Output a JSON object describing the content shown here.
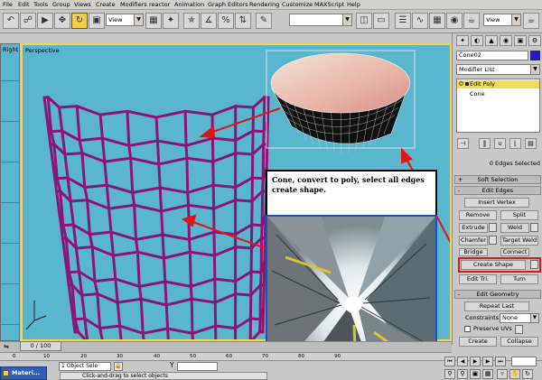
{
  "menu": [
    "File",
    "Edit",
    "Tools",
    "Group",
    "Views",
    "Create",
    "Modifiers",
    "reactor",
    "Animation",
    "Graph Editors",
    "Rendering",
    "Customize",
    "MAXScript",
    "Help"
  ],
  "toolbar": {
    "ref_coord": "View",
    "named_selection": "",
    "view2": "View"
  },
  "viewports": {
    "left_label": "Right",
    "main_label": "Perspective"
  },
  "tutorial": {
    "caption": "Cone, convert to poly, select all edges create shape."
  },
  "command_panel": {
    "object_name": "Cone02",
    "modifier_list": "Modifier List",
    "stack": [
      "Edit Poly",
      "Cone"
    ],
    "selection_status": "0 Edges Selected",
    "soft_selection": "Soft Selection",
    "edit_edges": {
      "title": "Edit Edges",
      "insert_vertex": "Insert Vertex",
      "remove": "Remove",
      "split": "Split",
      "extrude": "Extrude",
      "weld": "Weld",
      "chamfer": "Chamfer",
      "target_weld": "Target Weld",
      "bridge": "Bridge",
      "connect": "Connect",
      "create_shape": "Create Shape",
      "edit_tri": "Edit Tri.",
      "turn": "Turn"
    },
    "edit_geometry": {
      "title": "Edit Geometry",
      "repeat_last": "Repeat Last",
      "constraints_label": "Constraints:",
      "constraints_value": "None",
      "preserve_uvs": "Preserve UVs",
      "create": "Create",
      "collapse": "Collapse"
    }
  },
  "timeline": {
    "frame": "0 / 100",
    "ticks": [
      "0",
      "10",
      "20",
      "30",
      "40",
      "50",
      "60",
      "70",
      "80",
      "90"
    ]
  },
  "status": {
    "taskbar": "Materi...",
    "selection": "1 Object Sele",
    "y_label": "Y",
    "prompt": "Click-and-drag to select objects"
  },
  "colors": {
    "viewport_bg": "#5ab5cf",
    "active_border": "#f1d54c",
    "net": "#8c1478",
    "annotation_red": "#e01515",
    "object_color": "#1a1ad8"
  }
}
